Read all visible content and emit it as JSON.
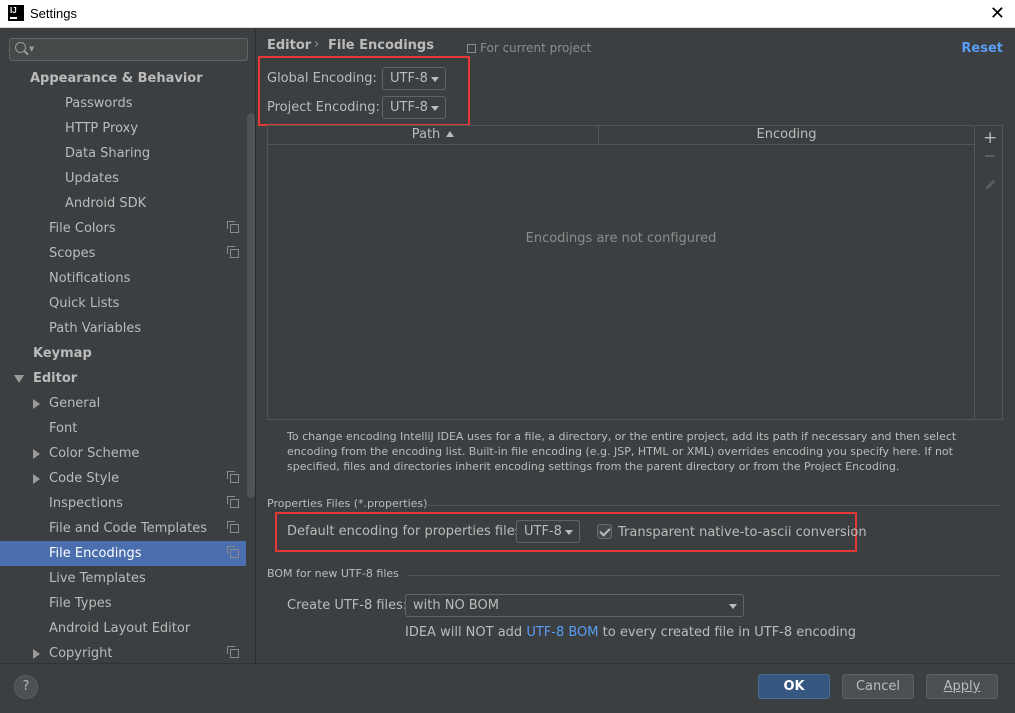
{
  "window": {
    "title": "Settings",
    "icon_name": "intellij-icon",
    "close_glyph": "✕"
  },
  "sidebar": {
    "search": {
      "value": "",
      "placeholder": ""
    },
    "items": [
      {
        "label": "Appearance & Behavior",
        "level": 0,
        "bold": true,
        "expand": "none",
        "copy_icon": false,
        "selected": false
      },
      {
        "label": "Passwords",
        "level": 2,
        "bold": false,
        "expand": "none",
        "copy_icon": false,
        "selected": false
      },
      {
        "label": "HTTP Proxy",
        "level": 2,
        "bold": false,
        "expand": "none",
        "copy_icon": false,
        "selected": false
      },
      {
        "label": "Data Sharing",
        "level": 2,
        "bold": false,
        "expand": "none",
        "copy_icon": false,
        "selected": false
      },
      {
        "label": "Updates",
        "level": 2,
        "bold": false,
        "expand": "none",
        "copy_icon": false,
        "selected": false
      },
      {
        "label": "Android SDK",
        "level": 2,
        "bold": false,
        "expand": "none",
        "copy_icon": false,
        "selected": false
      },
      {
        "label": "File Colors",
        "level": 1,
        "bold": false,
        "expand": "none",
        "copy_icon": true,
        "selected": false
      },
      {
        "label": "Scopes",
        "level": 1,
        "bold": false,
        "expand": "none",
        "copy_icon": true,
        "selected": false
      },
      {
        "label": "Notifications",
        "level": 1,
        "bold": false,
        "expand": "none",
        "copy_icon": false,
        "selected": false
      },
      {
        "label": "Quick Lists",
        "level": 1,
        "bold": false,
        "expand": "none",
        "copy_icon": false,
        "selected": false
      },
      {
        "label": "Path Variables",
        "level": 1,
        "bold": false,
        "expand": "none",
        "copy_icon": false,
        "selected": false
      },
      {
        "label": "Keymap",
        "level": 0,
        "bold": true,
        "expand": "none",
        "copy_icon": false,
        "selected": false
      },
      {
        "label": "Editor",
        "level": 0,
        "bold": true,
        "expand": "expanded",
        "copy_icon": false,
        "selected": false
      },
      {
        "label": "General",
        "level": 1,
        "bold": false,
        "expand": "collapsed",
        "copy_icon": false,
        "selected": false
      },
      {
        "label": "Font",
        "level": 1,
        "bold": false,
        "expand": "none",
        "copy_icon": false,
        "selected": false
      },
      {
        "label": "Color Scheme",
        "level": 1,
        "bold": false,
        "expand": "collapsed",
        "copy_icon": false,
        "selected": false
      },
      {
        "label": "Code Style",
        "level": 1,
        "bold": false,
        "expand": "collapsed",
        "copy_icon": true,
        "selected": false
      },
      {
        "label": "Inspections",
        "level": 1,
        "bold": false,
        "expand": "none",
        "copy_icon": true,
        "selected": false
      },
      {
        "label": "File and Code Templates",
        "level": 1,
        "bold": false,
        "expand": "none",
        "copy_icon": true,
        "selected": false
      },
      {
        "label": "File Encodings",
        "level": 1,
        "bold": false,
        "expand": "none",
        "copy_icon": true,
        "selected": true
      },
      {
        "label": "Live Templates",
        "level": 1,
        "bold": false,
        "expand": "none",
        "copy_icon": false,
        "selected": false
      },
      {
        "label": "File Types",
        "level": 1,
        "bold": false,
        "expand": "none",
        "copy_icon": false,
        "selected": false
      },
      {
        "label": "Android Layout Editor",
        "level": 1,
        "bold": false,
        "expand": "none",
        "copy_icon": false,
        "selected": false
      },
      {
        "label": "Copyright",
        "level": 1,
        "bold": false,
        "expand": "collapsed",
        "copy_icon": true,
        "selected": false
      }
    ]
  },
  "main": {
    "breadcrumb": {
      "parent": "Editor",
      "sep": "›",
      "current": "File Encodings"
    },
    "for_project": "For current project",
    "reset": "Reset",
    "global_encoding": {
      "label": "Global Encoding:",
      "value": "UTF-8"
    },
    "project_encoding": {
      "label": "Project Encoding:",
      "value": "UTF-8"
    },
    "table": {
      "columns": [
        "Path",
        "Encoding"
      ],
      "empty_text": "Encodings are not configured",
      "add_glyph": "+"
    },
    "help_text": "To change encoding IntelliJ IDEA uses for a file, a directory, or the entire project, add its path if necessary and then select encoding from the encoding list. Built-in file encoding (e.g. JSP, HTML or XML) overrides encoding you specify here. If not specified, files and directories inherit encoding settings from the parent directory or from the Project Encoding.",
    "properties": {
      "section": "Properties Files (*.properties)",
      "label": "Default encoding for properties files:",
      "value": "UTF-8",
      "checkbox_label": "Transparent native-to-ascii conversion",
      "checked": true
    },
    "bom": {
      "section": "BOM for new UTF-8 files",
      "label": "Create UTF-8 files:",
      "value": "with NO BOM",
      "note_prefix": "IDEA will NOT add",
      "note_link": "UTF-8 BOM",
      "note_suffix": "to every created file in UTF-8 encoding"
    }
  },
  "footer": {
    "help": "?",
    "ok": "OK",
    "cancel": "Cancel",
    "apply": "Apply"
  },
  "colors": {
    "accent": "#4b6eaf",
    "link": "#589df6",
    "highlight_box": "#e53935",
    "background": "#3c3f41"
  }
}
